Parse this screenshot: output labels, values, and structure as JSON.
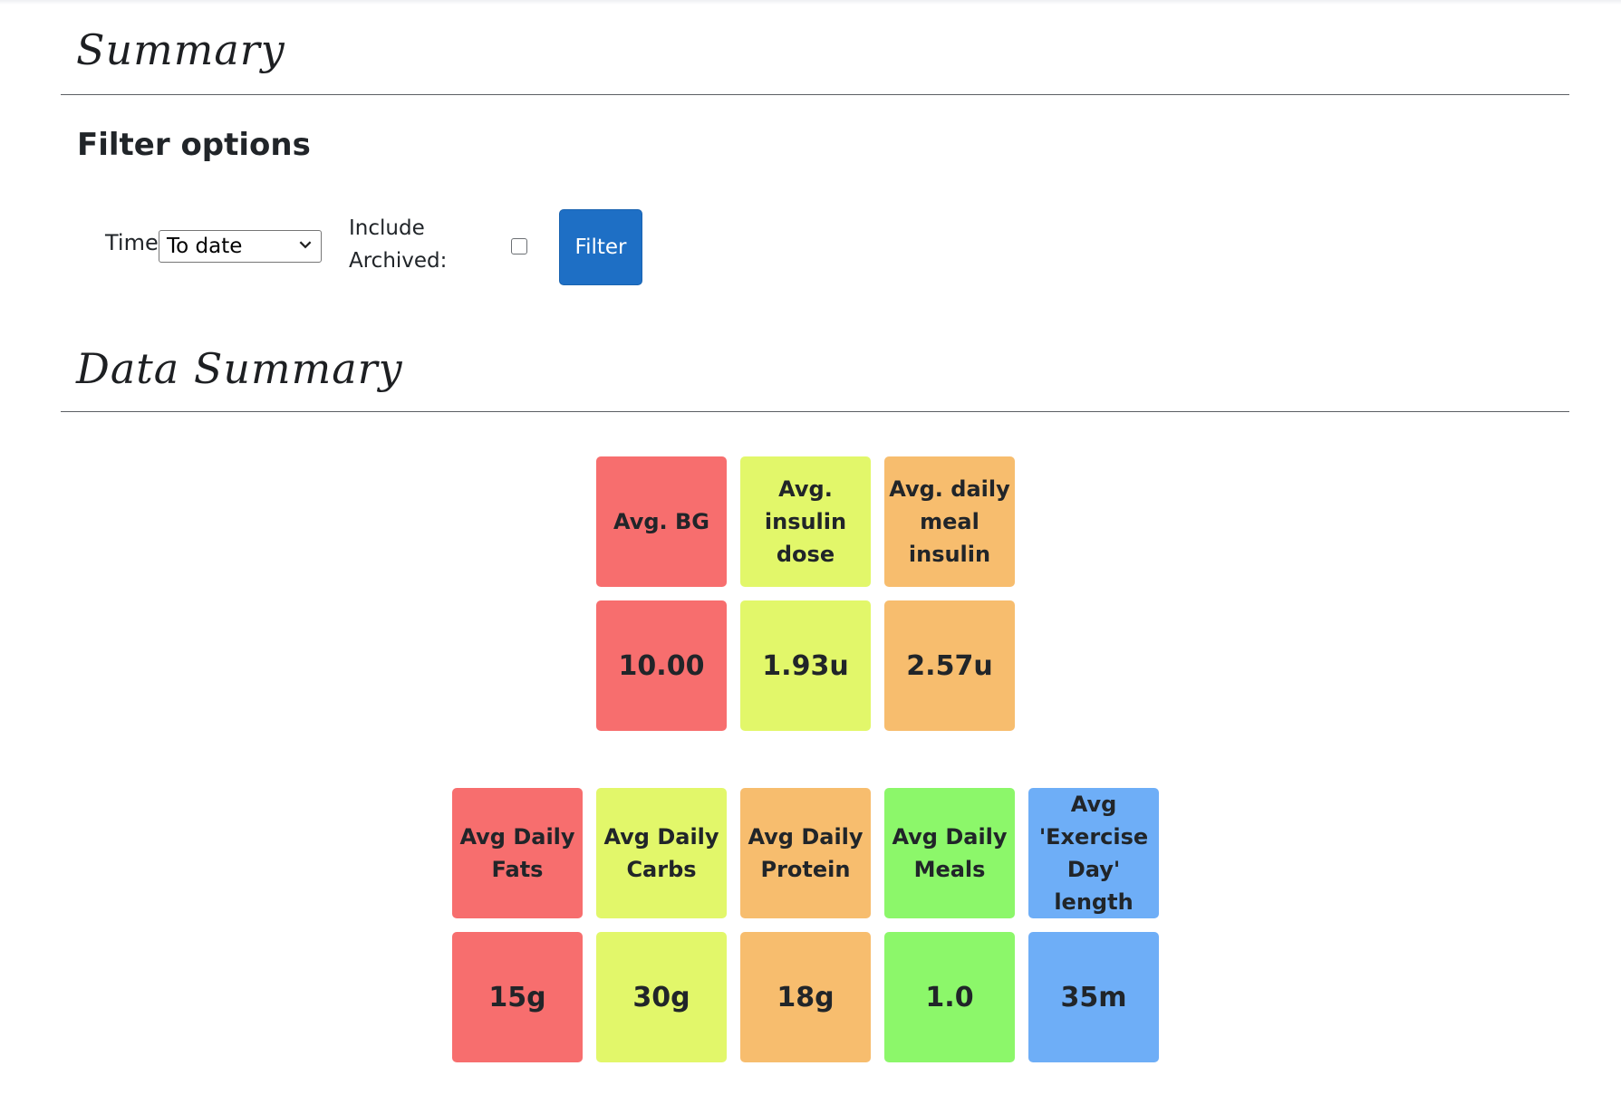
{
  "colors": {
    "red": "#f76e6e",
    "yellow": "#e2f76a",
    "orange": "#f7bd6e",
    "green": "#8cf76a",
    "blue": "#6eaef7",
    "filter_button": "#1e6fc5"
  },
  "summary": {
    "title": "Summary"
  },
  "filter": {
    "heading": "Filter options",
    "time_label": "Time:",
    "time_selected": "To date",
    "archived_label_line1": "Include",
    "archived_label_line2": "Archived:",
    "archived_checked": false,
    "button_label": "Filter"
  },
  "data_summary": {
    "title": "Data Summary",
    "row1": [
      {
        "label": "Avg. BG",
        "value": "10.00",
        "color": "red"
      },
      {
        "label": "Avg. insulin dose",
        "value": "1.93u",
        "color": "yellow"
      },
      {
        "label": "Avg. daily meal insulin",
        "value": "2.57u",
        "color": "orange"
      }
    ],
    "row2": [
      {
        "label": "Avg Daily Fats",
        "value": "15g",
        "color": "red"
      },
      {
        "label": "Avg Daily Carbs",
        "value": "30g",
        "color": "yellow"
      },
      {
        "label": "Avg Daily Protein",
        "value": "18g",
        "color": "orange"
      },
      {
        "label": "Avg Daily Meals",
        "value": "1.0",
        "color": "green"
      },
      {
        "label": "Avg 'Exercise Day' length",
        "value": "35m",
        "color": "blue"
      }
    ]
  }
}
